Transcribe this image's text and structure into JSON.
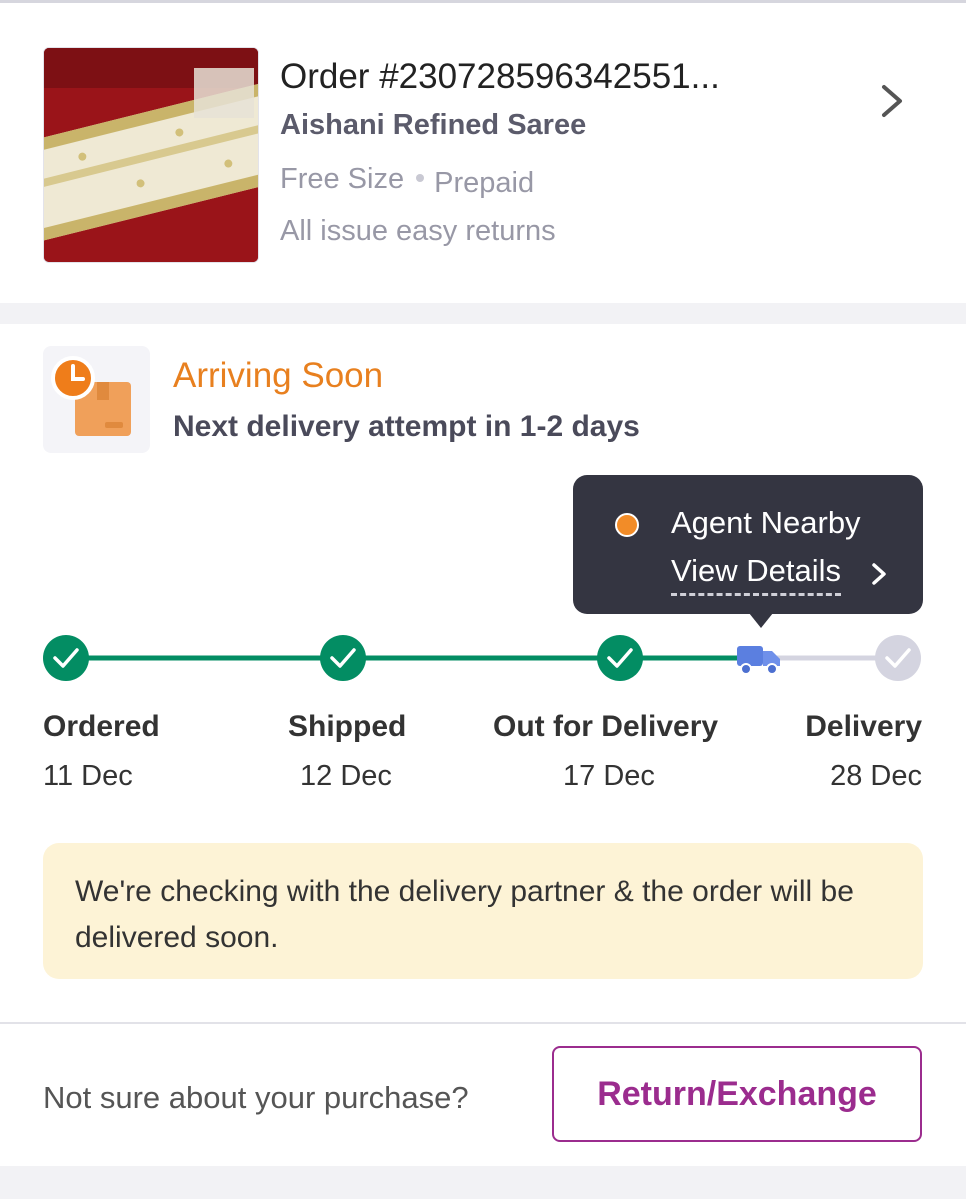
{
  "order": {
    "title": "Order #230728596342551...",
    "product_name": "Aishani Refined Saree",
    "size": "Free Size",
    "payment": "Prepaid",
    "returns_policy": "All issue easy returns",
    "chevron_icon": "chevron-right-icon"
  },
  "status": {
    "icon": "delivery-clock-box-icon",
    "title": "Arriving Soon",
    "subtitle": "Next delivery attempt in 1-2 days",
    "title_color": "#e8801f"
  },
  "tooltip": {
    "label": "Agent Nearby",
    "link": "View Details",
    "dot_color": "#f28c28"
  },
  "tracker": {
    "steps": [
      {
        "label": "Ordered",
        "date": "11 Dec",
        "state": "done"
      },
      {
        "label": "Shipped",
        "date": "12 Dec",
        "state": "done"
      },
      {
        "label": "Out for Delivery",
        "date": "17 Dec",
        "state": "done"
      },
      {
        "label": "Delivery",
        "date": "28 Dec",
        "state": "pending"
      }
    ],
    "current_icon": "truck-icon",
    "done_color": "#038d63",
    "pending_color": "#d4d4e0"
  },
  "info_message": "We're checking with the delivery partner & the order will be delivered soon.",
  "footer": {
    "prompt": "Not sure about your purchase?",
    "button_label": "Return/Exchange",
    "accent": "#9b2c8e"
  }
}
